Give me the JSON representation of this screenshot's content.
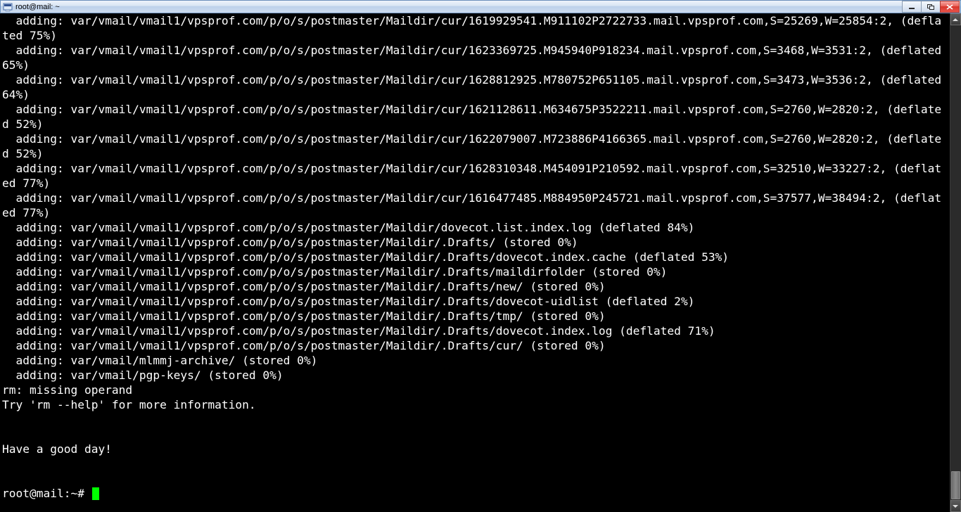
{
  "title": "root@mail: ~",
  "terminal": {
    "lines": [
      "  adding: var/vmail/vmail1/vpsprof.com/p/o/s/postmaster/Maildir/cur/1619929541.M911102P2722733.mail.vpsprof.com,S=25269,W=25854:2, (deflated 75%)",
      "  adding: var/vmail/vmail1/vpsprof.com/p/o/s/postmaster/Maildir/cur/1623369725.M945940P918234.mail.vpsprof.com,S=3468,W=3531:2, (deflated 65%)",
      "  adding: var/vmail/vmail1/vpsprof.com/p/o/s/postmaster/Maildir/cur/1628812925.M780752P651105.mail.vpsprof.com,S=3473,W=3536:2, (deflated 64%)",
      "  adding: var/vmail/vmail1/vpsprof.com/p/o/s/postmaster/Maildir/cur/1621128611.M634675P3522211.mail.vpsprof.com,S=2760,W=2820:2, (deflated 52%)",
      "  adding: var/vmail/vmail1/vpsprof.com/p/o/s/postmaster/Maildir/cur/1622079007.M723886P4166365.mail.vpsprof.com,S=2760,W=2820:2, (deflated 52%)",
      "  adding: var/vmail/vmail1/vpsprof.com/p/o/s/postmaster/Maildir/cur/1628310348.M454091P210592.mail.vpsprof.com,S=32510,W=33227:2, (deflated 77%)",
      "  adding: var/vmail/vmail1/vpsprof.com/p/o/s/postmaster/Maildir/cur/1616477485.M884950P245721.mail.vpsprof.com,S=37577,W=38494:2, (deflated 77%)",
      "  adding: var/vmail/vmail1/vpsprof.com/p/o/s/postmaster/Maildir/dovecot.list.index.log (deflated 84%)",
      "  adding: var/vmail/vmail1/vpsprof.com/p/o/s/postmaster/Maildir/.Drafts/ (stored 0%)",
      "  adding: var/vmail/vmail1/vpsprof.com/p/o/s/postmaster/Maildir/.Drafts/dovecot.index.cache (deflated 53%)",
      "  adding: var/vmail/vmail1/vpsprof.com/p/o/s/postmaster/Maildir/.Drafts/maildirfolder (stored 0%)",
      "  adding: var/vmail/vmail1/vpsprof.com/p/o/s/postmaster/Maildir/.Drafts/new/ (stored 0%)",
      "  adding: var/vmail/vmail1/vpsprof.com/p/o/s/postmaster/Maildir/.Drafts/dovecot-uidlist (deflated 2%)",
      "  adding: var/vmail/vmail1/vpsprof.com/p/o/s/postmaster/Maildir/.Drafts/tmp/ (stored 0%)",
      "  adding: var/vmail/vmail1/vpsprof.com/p/o/s/postmaster/Maildir/.Drafts/dovecot.index.log (deflated 71%)",
      "  adding: var/vmail/vmail1/vpsprof.com/p/o/s/postmaster/Maildir/.Drafts/cur/ (stored 0%)",
      "  adding: var/vmail/mlmmj-archive/ (stored 0%)",
      "  adding: var/vmail/pgp-keys/ (stored 0%)",
      "rm: missing operand",
      "Try 'rm --help' for more information.",
      "",
      "",
      "Have a good day!",
      "",
      ""
    ],
    "prompt": "root@mail:~# "
  }
}
